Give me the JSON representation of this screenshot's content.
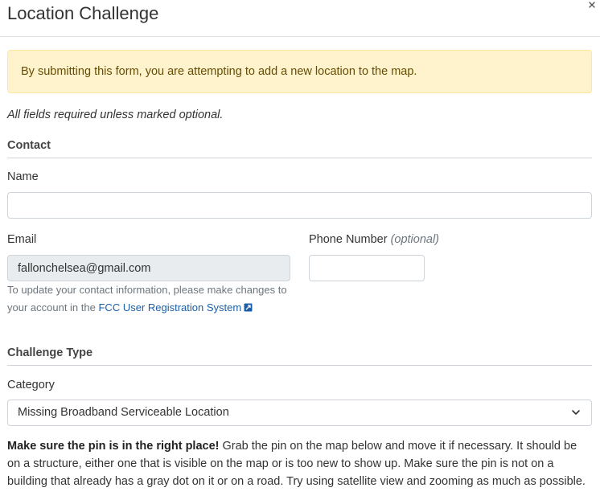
{
  "dialog": {
    "title": "Location Challenge",
    "close_label": ""
  },
  "alert": {
    "text": "By submitting this form, you are attempting to add a new location to the map."
  },
  "form": {
    "required_note": "All fields required unless marked optional.",
    "contact_section": {
      "title": "Contact",
      "name_label": "Name",
      "name_value": "",
      "email_label": "Email",
      "email_value": "fallonchelsea@gmail.com",
      "phone_label": "Phone Number",
      "phone_optional": "(optional)",
      "phone_value": "",
      "help_text": "To update your contact information, please make changes to your account in the",
      "help_link": "FCC User Registration System"
    },
    "challenge_section": {
      "title": "Challenge Type",
      "category_label": "Category",
      "category_selected": "Missing Broadband Serviceable Location"
    },
    "instructions": {
      "bold": "Make sure the pin is in the right place!",
      "text": "Grab the pin on the map below and move it if necessary. It should be on a structure, either one that is visible on the map or is too new to show up. Make sure the pin is not on a building that already has a gray dot on it or on a road. Try using satellite view and zooming as much as possible."
    }
  },
  "icons": {
    "close": "close-icon",
    "external_link": "external-link-icon",
    "chevron": "chevron-down-icon"
  },
  "colors": {
    "alert_background": "#fff3cd",
    "alert_text": "#664d03",
    "link": "#1a5fa8"
  }
}
